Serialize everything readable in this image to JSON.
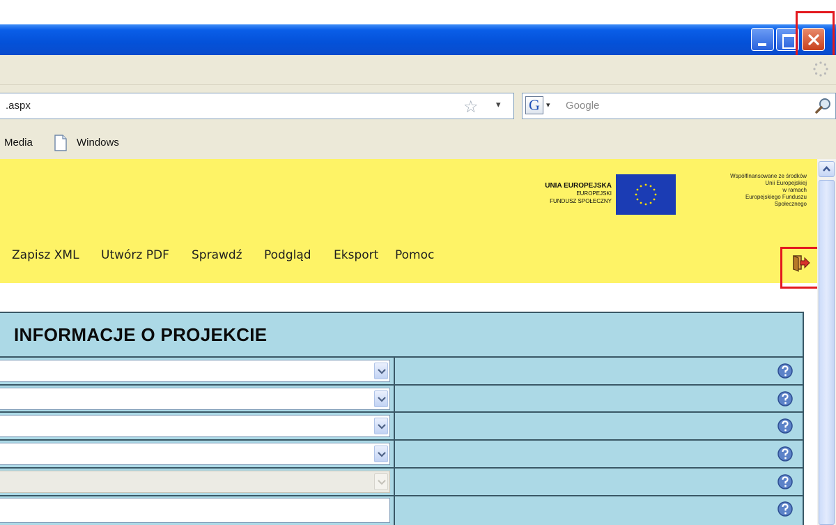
{
  "browser": {
    "address_value": ".aspx",
    "search_placeholder": "Google",
    "search_engine_letter": "G",
    "bookmarks": [
      "Media",
      "Windows"
    ]
  },
  "header": {
    "ue_line1": "UNIA EUROPEJSKA",
    "ue_line2": "EUROPEJSKI",
    "ue_line3": "FUNDUSZ SPOŁECZNY",
    "cofinance_lines": [
      "Współfinansowane ze środków",
      "Unii Europejskiej",
      "w ramach",
      "Europejskiego Funduszu",
      "Społecznego"
    ],
    "flag_color": "#1b3cb4",
    "background_color": "#fef366"
  },
  "menu": {
    "items": [
      "Zapisz XML",
      "Utwórz PDF",
      "Sprawdź",
      "Podgląd",
      "Eksport",
      "Pomoc"
    ]
  },
  "panel": {
    "title": "INFORMACJE O PROJEKCIE",
    "background_color": "#acd9e6",
    "rows": [
      {
        "type": "select",
        "value": "",
        "enabled": true
      },
      {
        "type": "select",
        "value": "",
        "enabled": true
      },
      {
        "type": "select",
        "value": "",
        "enabled": true
      },
      {
        "type": "select",
        "value": "",
        "enabled": true
      },
      {
        "type": "select",
        "value": "",
        "enabled": false
      },
      {
        "type": "text",
        "value": "",
        "enabled": true
      }
    ]
  },
  "icons": {
    "close": "close-icon",
    "exit": "exit-door-icon",
    "help": "help-question-icon",
    "bookmark_page": "page-icon",
    "search": "magnifier-icon"
  }
}
